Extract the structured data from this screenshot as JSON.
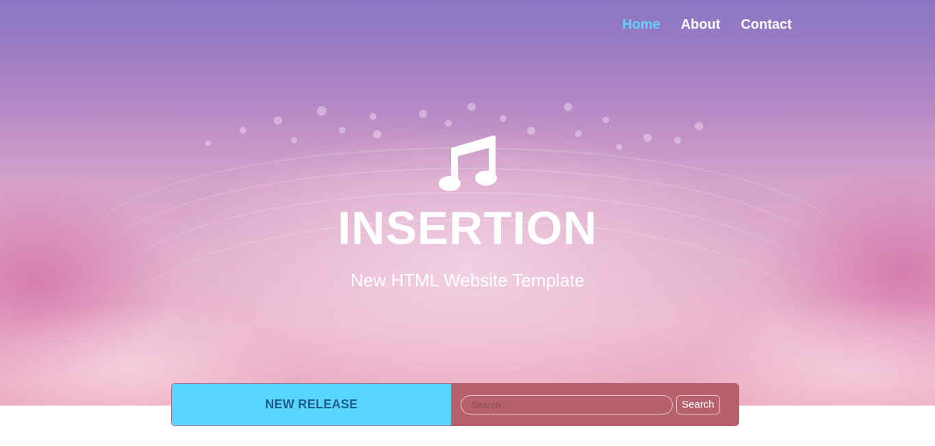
{
  "nav": {
    "items": [
      {
        "label": "Home",
        "active": true
      },
      {
        "label": "About",
        "active": false
      },
      {
        "label": "Contact",
        "active": false
      }
    ]
  },
  "hero": {
    "icon": "music-note-icon",
    "title": "INSERTION",
    "subtitle": "New HTML Website Template"
  },
  "bar": {
    "release_label": "NEW RELEASE",
    "search_placeholder": "Search...",
    "search_button_label": "Search"
  },
  "colors": {
    "nav_active": "#5fd3ff",
    "release_bg": "#58d6ff",
    "release_text": "#1e5d8a",
    "search_bg": "#b7616d"
  }
}
